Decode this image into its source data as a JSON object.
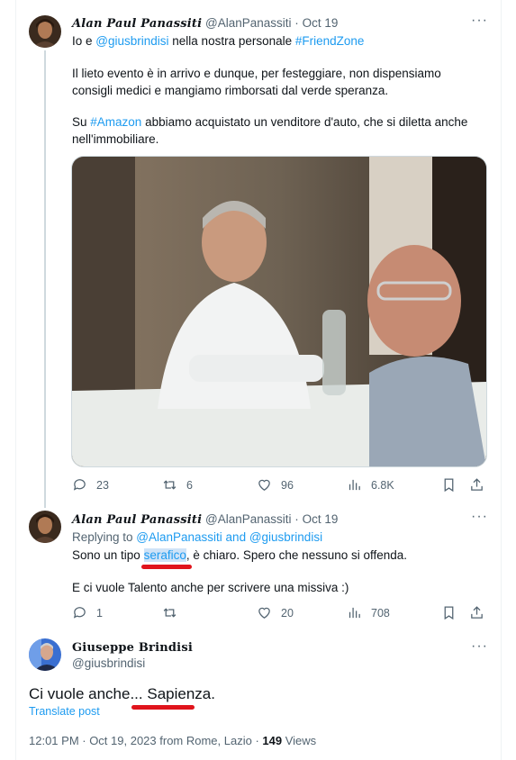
{
  "tweet1": {
    "display_name": "Alan Paul Panassiti",
    "handle": "@AlanPanassiti",
    "date": "Oct 19",
    "line1_prefix": "Io e ",
    "line1_mention": "@giusbrindisi",
    "line1_middle": " nella nostra personale ",
    "line1_hashtag": "#FriendZone",
    "para2_line1": "Il lieto evento è in arrivo e dunque, per festeggiare, non dispensiamo",
    "para2_line2": "consigli medici e mangiamo rimborsati dal verde speranza.",
    "para3_prefix": "Su ",
    "para3_hashtag": "#Amazon",
    "para3_rest": " abbiamo acquistato un venditore d'auto, che si diletta anche",
    "para3_line2": "nell'immobiliare.",
    "replies": "23",
    "reposts": "6",
    "likes": "96",
    "views": "6.8K"
  },
  "tweet2": {
    "display_name": "Alan Paul Panassiti",
    "handle": "@AlanPanassiti",
    "date": "Oct 19",
    "replying_label": "Replying to ",
    "replying_to": "@AlanPanassiti and @giusbrindisi",
    "line1_prefix": "Sono un tipo ",
    "line1_highlight": "serafico",
    "line1_rest": ", è chiaro. Spero che nessuno si offenda.",
    "line2": "E ci vuole Talento anche per scrivere una missiva :)",
    "replies": "1",
    "reposts": "",
    "likes": "20",
    "views": "708"
  },
  "tweet3": {
    "display_name": "Giuseppe Brindisi",
    "handle": "@giusbrindisi",
    "text": "Ci vuole anche... Sapienza.",
    "translate": "Translate post",
    "timestamp": "12:01 PM · Oct 19, 2023 from Rome, Lazio · ",
    "views_count": "149",
    "views_label": " Views"
  },
  "icons": [
    "more-icon",
    "reply-icon",
    "repost-icon",
    "like-icon",
    "views-icon",
    "bookmark-icon",
    "share-icon"
  ],
  "colors": {
    "link": "#1d9bf0",
    "muted": "#536471",
    "annotation": "#e0141c",
    "thread": "#cfd9de"
  }
}
